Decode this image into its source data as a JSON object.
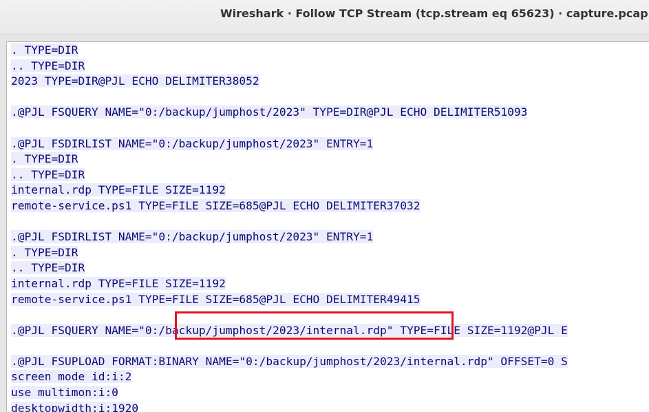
{
  "window": {
    "title": "Wireshark · Follow TCP Stream (tcp.stream eq 65623) · capture.pcap"
  },
  "stream": {
    "lines": [
      ". TYPE=DIR",
      ".. TYPE=DIR",
      "2023 TYPE=DIR@PJL ECHO DELIMITER38052",
      "",
      ".@PJL FSQUERY NAME=\"0:/backup/jumphost/2023\" TYPE=DIR@PJL ECHO DELIMITER51093",
      "",
      ".@PJL FSDIRLIST NAME=\"0:/backup/jumphost/2023\" ENTRY=1",
      ". TYPE=DIR",
      ".. TYPE=DIR",
      "internal.rdp TYPE=FILE SIZE=1192",
      "remote-service.ps1 TYPE=FILE SIZE=685@PJL ECHO DELIMITER37032",
      "",
      ".@PJL FSDIRLIST NAME=\"0:/backup/jumphost/2023\" ENTRY=1",
      ". TYPE=DIR",
      ".. TYPE=DIR",
      "internal.rdp TYPE=FILE SIZE=1192",
      "remote-service.ps1 TYPE=FILE SIZE=685@PJL ECHO DELIMITER49415",
      "",
      ".@PJL FSQUERY NAME=\"0:/backup/jumphost/2023/internal.rdp\" TYPE=FILE SIZE=1192@PJL E",
      "",
      ".@PJL FSUPLOAD FORMAT:BINARY NAME=\"0:/backup/jumphost/2023/internal.rdp\" OFFSET=0 S",
      "screen mode id:i:2",
      "use multimon:i:0",
      "desktopwidth:i:1920"
    ]
  },
  "colors": {
    "client_text": "#0d0d72",
    "client_background": "#ececfb",
    "highlight_border": "#e0141e"
  }
}
